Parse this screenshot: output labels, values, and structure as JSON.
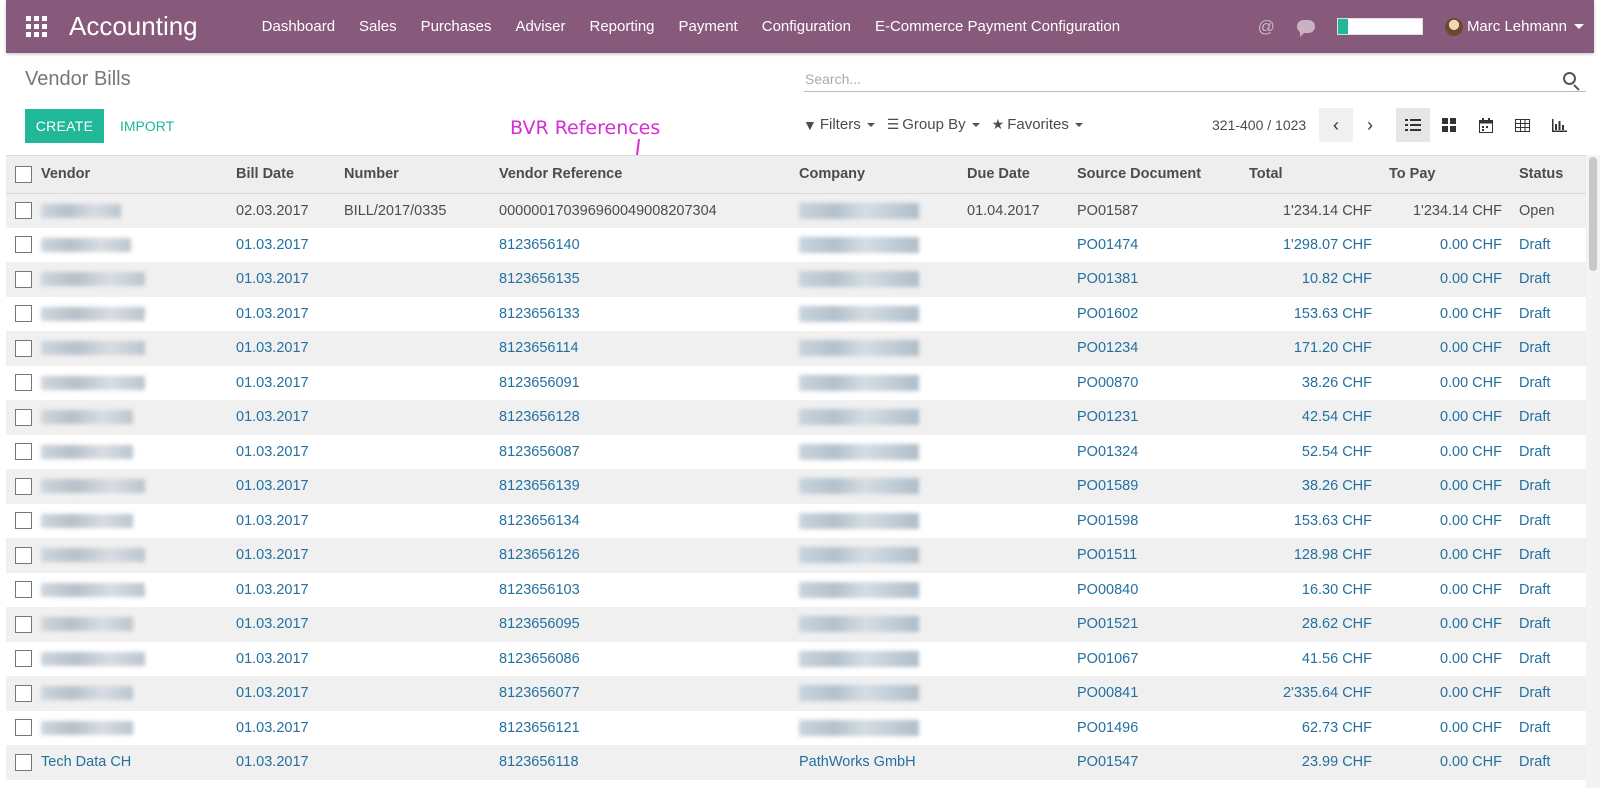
{
  "navbar": {
    "brand": "Accounting",
    "menu": [
      "Dashboard",
      "Sales",
      "Purchases",
      "Adviser",
      "Reporting",
      "Payment",
      "Configuration",
      "E-Commerce Payment Configuration"
    ],
    "user": "Marc Lehmann",
    "progress_fraction": 0.12,
    "color": "#875a7b"
  },
  "control": {
    "title": "Vendor Bills",
    "search_placeholder": "Search...",
    "create_label": "CREATE",
    "import_label": "IMPORT",
    "filters_label": "Filters",
    "groupby_label": "Group By",
    "favorites_label": "Favorites",
    "pager": "321-400 / 1023"
  },
  "annotation": "BVR References",
  "table": {
    "columns": [
      "Vendor",
      "Bill Date",
      "Number",
      "Vendor Reference",
      "Company",
      "Due Date",
      "Source Document",
      "Total",
      "To Pay",
      "Status"
    ],
    "rows": [
      {
        "vendor": "",
        "bill_date": "02.03.2017",
        "number": "BILL/2017/0335",
        "vendor_ref": "000000170396960049008207304",
        "company": "",
        "due_date": "01.04.2017",
        "source": "PO01587",
        "total": "1'234.14 CHF",
        "to_pay": "1'234.14 CHF",
        "status": "Open"
      },
      {
        "vendor": "",
        "bill_date": "01.03.2017",
        "number": "",
        "vendor_ref": "8123656140",
        "company": "",
        "due_date": "",
        "source": "PO01474",
        "total": "1'298.07 CHF",
        "to_pay": "0.00 CHF",
        "status": "Draft"
      },
      {
        "vendor": "",
        "bill_date": "01.03.2017",
        "number": "",
        "vendor_ref": "8123656135",
        "company": "",
        "due_date": "",
        "source": "PO01381",
        "total": "10.82 CHF",
        "to_pay": "0.00 CHF",
        "status": "Draft"
      },
      {
        "vendor": "",
        "bill_date": "01.03.2017",
        "number": "",
        "vendor_ref": "8123656133",
        "company": "",
        "due_date": "",
        "source": "PO01602",
        "total": "153.63 CHF",
        "to_pay": "0.00 CHF",
        "status": "Draft"
      },
      {
        "vendor": "",
        "bill_date": "01.03.2017",
        "number": "",
        "vendor_ref": "8123656114",
        "company": "",
        "due_date": "",
        "source": "PO01234",
        "total": "171.20 CHF",
        "to_pay": "0.00 CHF",
        "status": "Draft"
      },
      {
        "vendor": "",
        "bill_date": "01.03.2017",
        "number": "",
        "vendor_ref": "8123656091",
        "company": "",
        "due_date": "",
        "source": "PO00870",
        "total": "38.26 CHF",
        "to_pay": "0.00 CHF",
        "status": "Draft"
      },
      {
        "vendor": "",
        "bill_date": "01.03.2017",
        "number": "",
        "vendor_ref": "8123656128",
        "company": "",
        "due_date": "",
        "source": "PO01231",
        "total": "42.54 CHF",
        "to_pay": "0.00 CHF",
        "status": "Draft"
      },
      {
        "vendor": "",
        "bill_date": "01.03.2017",
        "number": "",
        "vendor_ref": "8123656087",
        "company": "",
        "due_date": "",
        "source": "PO01324",
        "total": "52.54 CHF",
        "to_pay": "0.00 CHF",
        "status": "Draft"
      },
      {
        "vendor": "",
        "bill_date": "01.03.2017",
        "number": "",
        "vendor_ref": "8123656139",
        "company": "",
        "due_date": "",
        "source": "PO01589",
        "total": "38.26 CHF",
        "to_pay": "0.00 CHF",
        "status": "Draft"
      },
      {
        "vendor": "",
        "bill_date": "01.03.2017",
        "number": "",
        "vendor_ref": "8123656134",
        "company": "",
        "due_date": "",
        "source": "PO01598",
        "total": "153.63 CHF",
        "to_pay": "0.00 CHF",
        "status": "Draft"
      },
      {
        "vendor": "",
        "bill_date": "01.03.2017",
        "number": "",
        "vendor_ref": "8123656126",
        "company": "",
        "due_date": "",
        "source": "PO01511",
        "total": "128.98 CHF",
        "to_pay": "0.00 CHF",
        "status": "Draft"
      },
      {
        "vendor": "",
        "bill_date": "01.03.2017",
        "number": "",
        "vendor_ref": "8123656103",
        "company": "",
        "due_date": "",
        "source": "PO00840",
        "total": "16.30 CHF",
        "to_pay": "0.00 CHF",
        "status": "Draft"
      },
      {
        "vendor": "",
        "bill_date": "01.03.2017",
        "number": "",
        "vendor_ref": "8123656095",
        "company": "",
        "due_date": "",
        "source": "PO01521",
        "total": "28.62 CHF",
        "to_pay": "0.00 CHF",
        "status": "Draft"
      },
      {
        "vendor": "",
        "bill_date": "01.03.2017",
        "number": "",
        "vendor_ref": "8123656086",
        "company": "",
        "due_date": "",
        "source": "PO01067",
        "total": "41.56 CHF",
        "to_pay": "0.00 CHF",
        "status": "Draft"
      },
      {
        "vendor": "",
        "bill_date": "01.03.2017",
        "number": "",
        "vendor_ref": "8123656077",
        "company": "",
        "due_date": "",
        "source": "PO00841",
        "total": "2'335.64 CHF",
        "to_pay": "0.00 CHF",
        "status": "Draft"
      },
      {
        "vendor": "",
        "bill_date": "01.03.2017",
        "number": "",
        "vendor_ref": "8123656121",
        "company": "",
        "due_date": "",
        "source": "PO01496",
        "total": "62.73 CHF",
        "to_pay": "0.00 CHF",
        "status": "Draft"
      },
      {
        "vendor": "Tech Data CH",
        "bill_date": "01.03.2017",
        "number": "",
        "vendor_ref": "8123656118",
        "company": "PathWorks GmbH",
        "due_date": "",
        "source": "PO01547",
        "total": "23.99 CHF",
        "to_pay": "0.00 CHF",
        "status": "Draft"
      }
    ]
  },
  "colors": {
    "accent": "#21b799",
    "link": "#23709f",
    "annotation": "#d72bd8"
  }
}
